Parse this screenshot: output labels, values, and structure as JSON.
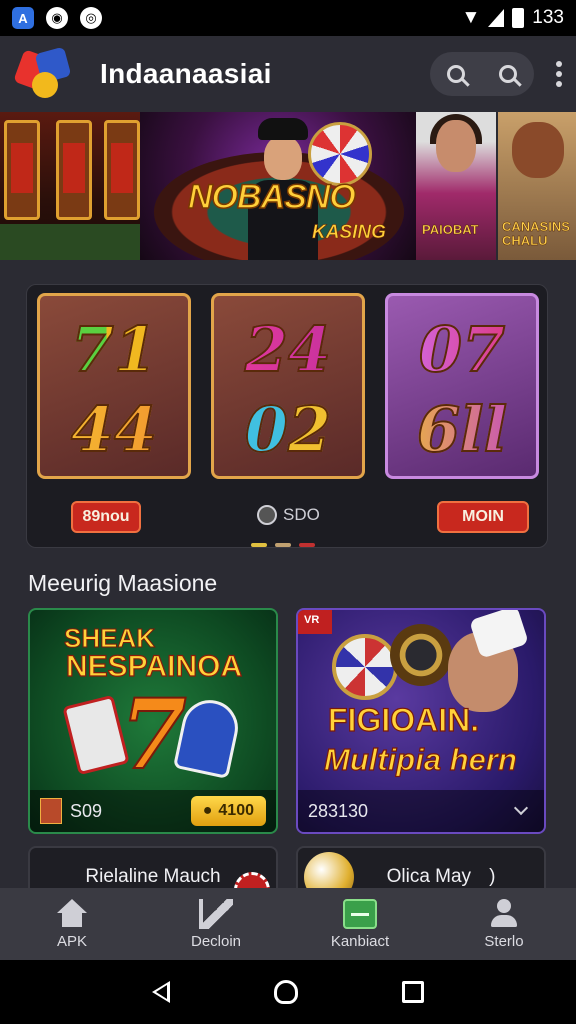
{
  "status_bar": {
    "time": "133",
    "left_icons": [
      "app-a-icon",
      "app-circle-icon",
      "app-circle-icon"
    ],
    "app_a_label": "A"
  },
  "header": {
    "title": "Indaanaasiai",
    "icons": [
      "search-icon",
      "search-alt-icon",
      "more-vertical-icon"
    ]
  },
  "banner": {
    "main_logo": "NOBASNO",
    "main_sub": "KASING",
    "tile1_label": "PAIOBAT",
    "tile2_label": "CANASINS CHALU"
  },
  "slot_panel": {
    "reels": [
      {
        "top": "71",
        "bottom": "44"
      },
      {
        "top": "24",
        "bottom": "02"
      },
      {
        "top": "07",
        "bottom": "6ll"
      }
    ],
    "left_button": "89nou",
    "center_value": "SDO",
    "right_button": "MOIN",
    "dot_colors": [
      "#e0c040",
      "#c0a070",
      "#c03030"
    ]
  },
  "section": {
    "title": "Meeurig Maasione"
  },
  "cards": [
    {
      "title_top": "SHEAK",
      "title_main": "NESPAINOA",
      "big_symbol": "7",
      "footer_value": "S09",
      "button_label": "4100"
    },
    {
      "corner_tag": "VR",
      "title_top": "FIGIOAIN.",
      "title_main": "Multipia hern",
      "footer_value": "283130"
    }
  ],
  "cards_row2": [
    {
      "label": "Rielaline Mauch"
    },
    {
      "label": "Olica May",
      "suffix": ")"
    }
  ],
  "bottom_nav": [
    {
      "label": "APK",
      "icon": "home-icon"
    },
    {
      "label": "Decloin",
      "icon": "flag-icon"
    },
    {
      "label": "Kanbiact",
      "icon": "wallet-icon"
    },
    {
      "label": "Sterlo",
      "icon": "user-icon"
    }
  ]
}
